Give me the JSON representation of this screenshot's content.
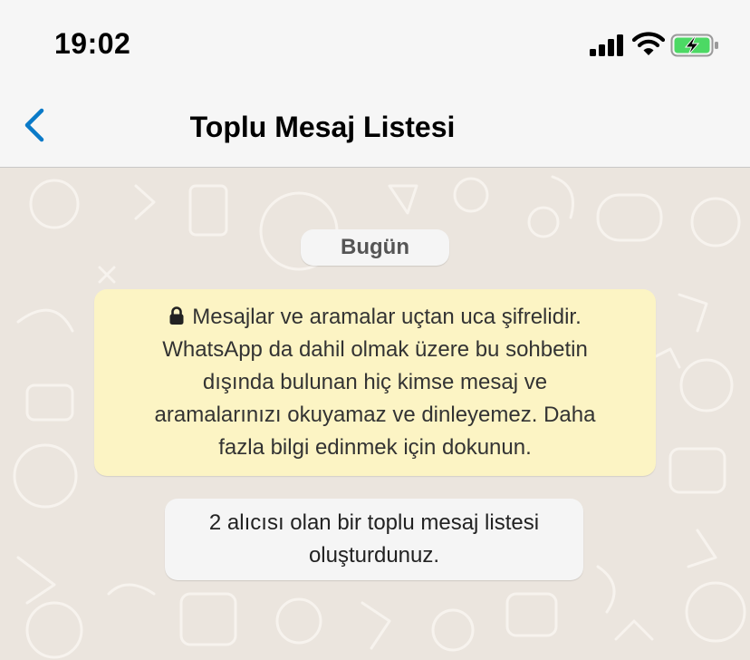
{
  "status_bar": {
    "time": "19:02",
    "signal_icon": "cellular-signal-icon",
    "wifi_icon": "wifi-icon",
    "battery_icon": "battery-charging-icon",
    "battery_color": "#4cd964"
  },
  "nav": {
    "back_icon": "chevron-left-icon",
    "title": "Toplu Mesaj Listesi",
    "accent_color": "#0a7ac8"
  },
  "chat": {
    "date_label": "Bugün",
    "encryption_notice": {
      "icon": "lock-icon",
      "lines": [
        "Mesajlar ve aramalar uçtan uca şifrelidir.",
        "WhatsApp da dahil olmak üzere bu sohbetin",
        "dışında bulunan hiç kimse mesaj ve",
        "aramalarınızı okuyamaz ve dinleyemez. Daha",
        "fazla bilgi edinmek için dokunun."
      ],
      "background_color": "#fcf4c4"
    },
    "system_message": {
      "lines": [
        "2 alıcısı olan bir toplu mesaj listesi",
        "oluşturdunuz."
      ]
    },
    "wallpaper_color": "#ebe5de"
  }
}
